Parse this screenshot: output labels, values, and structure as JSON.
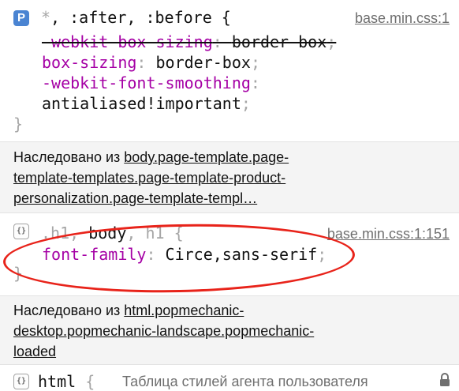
{
  "rule1": {
    "badge": "P",
    "selector_main": "*",
    "selector_rest": ", :after, :before {",
    "source": "base.min.css:1",
    "declarations": [
      {
        "prop": "-webkit-box-sizing",
        "value": "border-box",
        "overridden": true
      },
      {
        "prop": "box-sizing",
        "value": "border-box",
        "overridden": false
      },
      {
        "prop": "-webkit-font-smoothing",
        "value": "",
        "overridden": false
      }
    ],
    "continuation": "antialiased!important",
    "close": "}"
  },
  "inherited1": {
    "prefix": "Наследовано из ",
    "link_lines": [
      "body.page-template.page-",
      "template-templates.page-template-product-",
      "personalization.page-template-templ…"
    ]
  },
  "rule2": {
    "selector_dim1": ".h1, ",
    "selector_main": "body",
    "selector_dim2": ", h1 {",
    "source": "base.min.css:1:151",
    "declarations": [
      {
        "prop": "font-family",
        "value": "Circe,sans-serif"
      }
    ],
    "close": "}",
    "highlight_color": "#e8231a"
  },
  "inherited2": {
    "prefix": "Наследовано из ",
    "link_lines": [
      "html.popmechanic-",
      "desktop.popmechanic-landscape.popmechanic-",
      "loaded"
    ]
  },
  "rule3": {
    "selector": "html",
    "brace": "{",
    "source": "Таблица стилей агента пользователя"
  }
}
